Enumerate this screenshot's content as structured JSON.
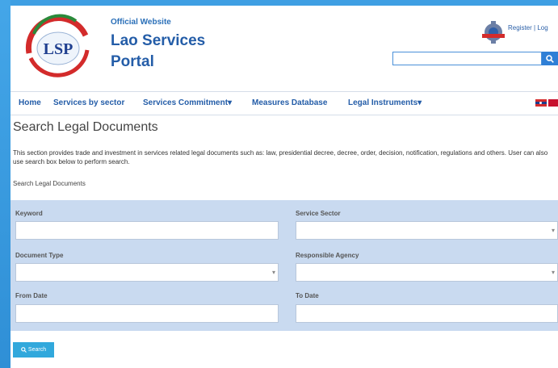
{
  "header": {
    "logo_text": "LSP",
    "tagline": "Official Website",
    "site_name_line1": "Lao Services",
    "site_name_line2": "Portal",
    "register_label": "Register",
    "login_label": "Log",
    "search_button_icon": "search-icon"
  },
  "nav": {
    "items": [
      {
        "label": "Home"
      },
      {
        "label": "Services by sector"
      },
      {
        "label": "Services Commitment"
      },
      {
        "label": "Measures Database"
      },
      {
        "label": "Legal Instruments"
      }
    ],
    "dropdown_marker": "▾"
  },
  "page": {
    "title": "Search Legal Documents",
    "description": "This section provides trade and investment in services related legal documents such as: law, presidential decree, decree, order, decision, notification, regulations and others. User can also use search box below to perform search.",
    "subheading": "Search Legal Documents"
  },
  "form": {
    "keyword_label": "Keyword",
    "keyword_value": "",
    "service_sector_label": "Service Sector",
    "service_sector_value": "",
    "document_type_label": "Document Type",
    "document_type_value": "",
    "responsible_agency_label": "Responsible Agency",
    "responsible_agency_value": "",
    "from_date_label": "From Date",
    "from_date_value": "",
    "to_date_label": "To Date",
    "to_date_value": "",
    "select_caret": "▾"
  },
  "search_button": {
    "label": "Search",
    "icon": "search-icon"
  },
  "colors": {
    "accent": "#2f7fd6",
    "form_bg": "#c9daf0",
    "button": "#31a8dc"
  }
}
